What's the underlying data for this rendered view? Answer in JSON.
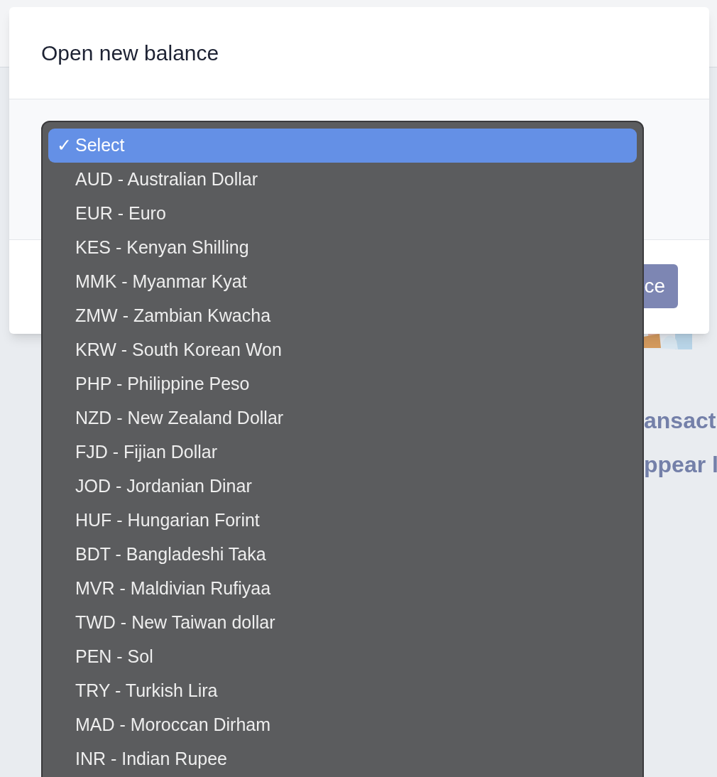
{
  "dialog": {
    "title": "Open new balance",
    "button": {
      "label": "ce"
    }
  },
  "dropdown": {
    "check_mark": "✓",
    "options": [
      {
        "label": "Select",
        "selected": true
      },
      {
        "label": "AUD - Australian Dollar",
        "selected": false
      },
      {
        "label": "EUR - Euro",
        "selected": false
      },
      {
        "label": "KES - Kenyan Shilling",
        "selected": false
      },
      {
        "label": "MMK - Myanmar Kyat",
        "selected": false
      },
      {
        "label": "ZMW - Zambian Kwacha",
        "selected": false
      },
      {
        "label": "KRW - South Korean Won",
        "selected": false
      },
      {
        "label": "PHP - Philippine Peso",
        "selected": false
      },
      {
        "label": "NZD - New Zealand Dollar",
        "selected": false
      },
      {
        "label": "FJD - Fijian Dollar",
        "selected": false
      },
      {
        "label": "JOD - Jordanian Dinar",
        "selected": false
      },
      {
        "label": "HUF - Hungarian Forint",
        "selected": false
      },
      {
        "label": "BDT - Bangladeshi Taka",
        "selected": false
      },
      {
        "label": "MVR - Maldivian Rufiyaa",
        "selected": false
      },
      {
        "label": "TWD - New Taiwan dollar",
        "selected": false
      },
      {
        "label": "PEN - Sol",
        "selected": false
      },
      {
        "label": "TRY - Turkish Lira",
        "selected": false
      },
      {
        "label": "MAD - Moroccan Dirham",
        "selected": false
      },
      {
        "label": "INR - Indian Rupee",
        "selected": false
      }
    ]
  },
  "empty_state": {
    "lines": [
      "ansact",
      "ppear l"
    ]
  }
}
